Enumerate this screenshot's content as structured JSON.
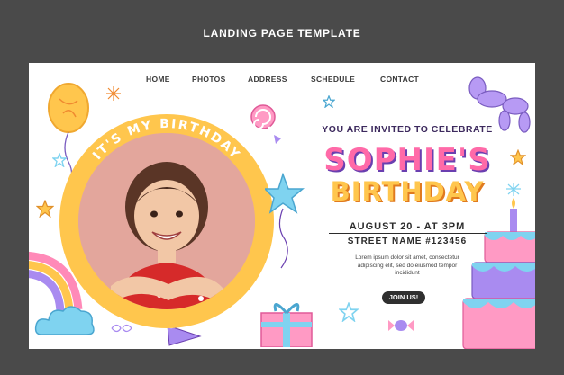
{
  "page_heading": "LANDING PAGE TEMPLATE",
  "nav": {
    "items": [
      {
        "label": "HOME"
      },
      {
        "label": "PHOTOS"
      },
      {
        "label": "ADDRESS"
      },
      {
        "label": "SCHEDULE"
      },
      {
        "label": "CONTACT"
      }
    ]
  },
  "hero": {
    "arc_text": "IT'S MY BIRTHDAY",
    "invite_text": "YOU ARE INVITED TO CELEBRATE",
    "title_line1": "SOPHIE'S",
    "title_line2": "BIRTHDAY",
    "date_time": "AUGUST 20 - AT 3PM",
    "address": "STREET NAME #123456",
    "body_line1": "Lorem ipsum dolor sit amet, consectetur",
    "body_line2": "adipiscing elit, sed do eiusmod tempor",
    "body_line3": "incididunt",
    "cta_label": "JOIN US!"
  },
  "colors": {
    "background": "#4a4a4a",
    "canvas": "#ffffff",
    "ring": "#ffc64d",
    "pink": "#ff6aa8",
    "yellow": "#ffc64d",
    "purple": "#a98bf0",
    "teal": "#7fd3f0",
    "button": "#2f2f2f"
  },
  "icons": [
    "balloon-icon",
    "lollipop-icon",
    "star-icon",
    "balloon-dog-icon",
    "cake-icon",
    "gift-icon",
    "rainbow-icon",
    "cloud-icon",
    "candy-icon",
    "party-hat-icon",
    "sparkle-icon"
  ]
}
